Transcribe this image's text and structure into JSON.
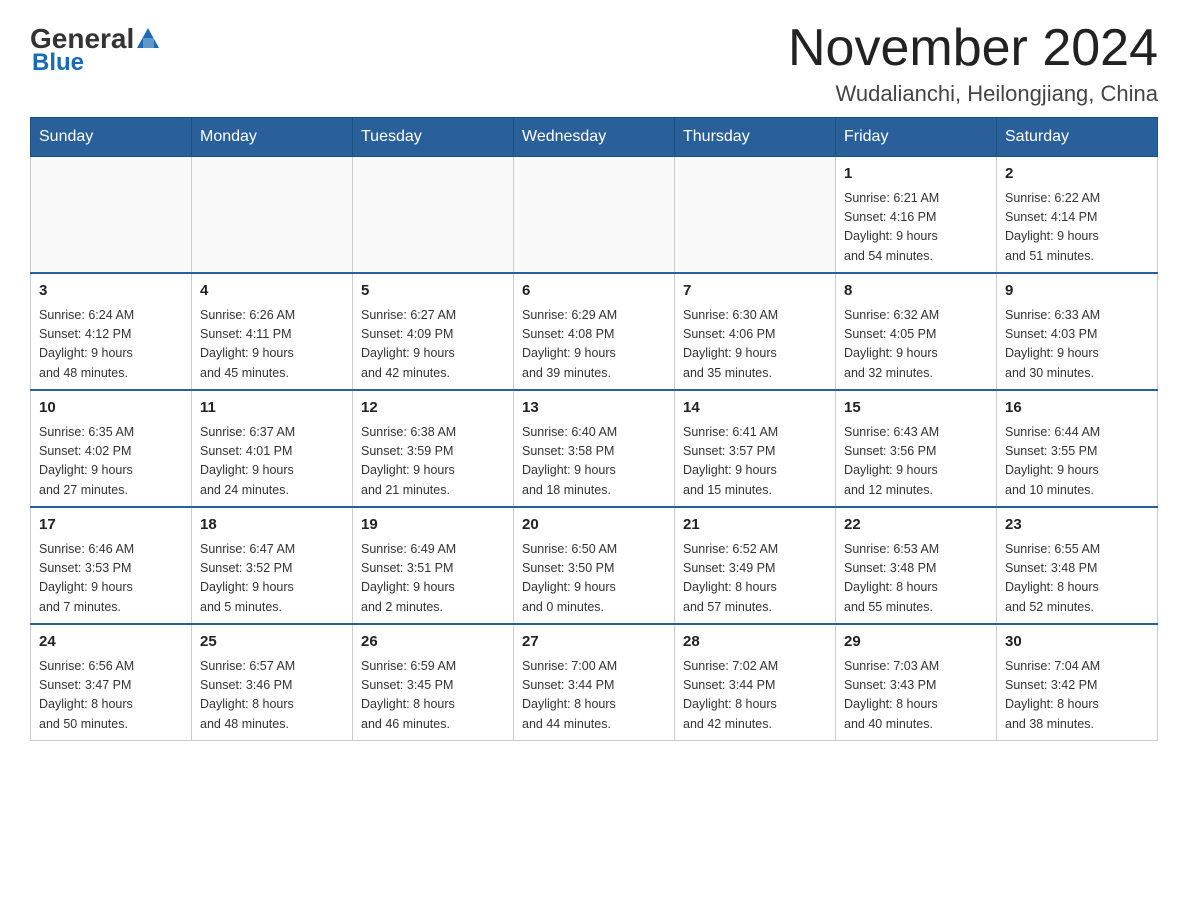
{
  "logo": {
    "text1": "General",
    "text2": "Blue"
  },
  "title": "November 2024",
  "subtitle": "Wudalianchi, Heilongjiang, China",
  "headers": [
    "Sunday",
    "Monday",
    "Tuesday",
    "Wednesday",
    "Thursday",
    "Friday",
    "Saturday"
  ],
  "weeks": [
    [
      {
        "day": "",
        "info": ""
      },
      {
        "day": "",
        "info": ""
      },
      {
        "day": "",
        "info": ""
      },
      {
        "day": "",
        "info": ""
      },
      {
        "day": "",
        "info": ""
      },
      {
        "day": "1",
        "info": "Sunrise: 6:21 AM\nSunset: 4:16 PM\nDaylight: 9 hours\nand 54 minutes."
      },
      {
        "day": "2",
        "info": "Sunrise: 6:22 AM\nSunset: 4:14 PM\nDaylight: 9 hours\nand 51 minutes."
      }
    ],
    [
      {
        "day": "3",
        "info": "Sunrise: 6:24 AM\nSunset: 4:12 PM\nDaylight: 9 hours\nand 48 minutes."
      },
      {
        "day": "4",
        "info": "Sunrise: 6:26 AM\nSunset: 4:11 PM\nDaylight: 9 hours\nand 45 minutes."
      },
      {
        "day": "5",
        "info": "Sunrise: 6:27 AM\nSunset: 4:09 PM\nDaylight: 9 hours\nand 42 minutes."
      },
      {
        "day": "6",
        "info": "Sunrise: 6:29 AM\nSunset: 4:08 PM\nDaylight: 9 hours\nand 39 minutes."
      },
      {
        "day": "7",
        "info": "Sunrise: 6:30 AM\nSunset: 4:06 PM\nDaylight: 9 hours\nand 35 minutes."
      },
      {
        "day": "8",
        "info": "Sunrise: 6:32 AM\nSunset: 4:05 PM\nDaylight: 9 hours\nand 32 minutes."
      },
      {
        "day": "9",
        "info": "Sunrise: 6:33 AM\nSunset: 4:03 PM\nDaylight: 9 hours\nand 30 minutes."
      }
    ],
    [
      {
        "day": "10",
        "info": "Sunrise: 6:35 AM\nSunset: 4:02 PM\nDaylight: 9 hours\nand 27 minutes."
      },
      {
        "day": "11",
        "info": "Sunrise: 6:37 AM\nSunset: 4:01 PM\nDaylight: 9 hours\nand 24 minutes."
      },
      {
        "day": "12",
        "info": "Sunrise: 6:38 AM\nSunset: 3:59 PM\nDaylight: 9 hours\nand 21 minutes."
      },
      {
        "day": "13",
        "info": "Sunrise: 6:40 AM\nSunset: 3:58 PM\nDaylight: 9 hours\nand 18 minutes."
      },
      {
        "day": "14",
        "info": "Sunrise: 6:41 AM\nSunset: 3:57 PM\nDaylight: 9 hours\nand 15 minutes."
      },
      {
        "day": "15",
        "info": "Sunrise: 6:43 AM\nSunset: 3:56 PM\nDaylight: 9 hours\nand 12 minutes."
      },
      {
        "day": "16",
        "info": "Sunrise: 6:44 AM\nSunset: 3:55 PM\nDaylight: 9 hours\nand 10 minutes."
      }
    ],
    [
      {
        "day": "17",
        "info": "Sunrise: 6:46 AM\nSunset: 3:53 PM\nDaylight: 9 hours\nand 7 minutes."
      },
      {
        "day": "18",
        "info": "Sunrise: 6:47 AM\nSunset: 3:52 PM\nDaylight: 9 hours\nand 5 minutes."
      },
      {
        "day": "19",
        "info": "Sunrise: 6:49 AM\nSunset: 3:51 PM\nDaylight: 9 hours\nand 2 minutes."
      },
      {
        "day": "20",
        "info": "Sunrise: 6:50 AM\nSunset: 3:50 PM\nDaylight: 9 hours\nand 0 minutes."
      },
      {
        "day": "21",
        "info": "Sunrise: 6:52 AM\nSunset: 3:49 PM\nDaylight: 8 hours\nand 57 minutes."
      },
      {
        "day": "22",
        "info": "Sunrise: 6:53 AM\nSunset: 3:48 PM\nDaylight: 8 hours\nand 55 minutes."
      },
      {
        "day": "23",
        "info": "Sunrise: 6:55 AM\nSunset: 3:48 PM\nDaylight: 8 hours\nand 52 minutes."
      }
    ],
    [
      {
        "day": "24",
        "info": "Sunrise: 6:56 AM\nSunset: 3:47 PM\nDaylight: 8 hours\nand 50 minutes."
      },
      {
        "day": "25",
        "info": "Sunrise: 6:57 AM\nSunset: 3:46 PM\nDaylight: 8 hours\nand 48 minutes."
      },
      {
        "day": "26",
        "info": "Sunrise: 6:59 AM\nSunset: 3:45 PM\nDaylight: 8 hours\nand 46 minutes."
      },
      {
        "day": "27",
        "info": "Sunrise: 7:00 AM\nSunset: 3:44 PM\nDaylight: 8 hours\nand 44 minutes."
      },
      {
        "day": "28",
        "info": "Sunrise: 7:02 AM\nSunset: 3:44 PM\nDaylight: 8 hours\nand 42 minutes."
      },
      {
        "day": "29",
        "info": "Sunrise: 7:03 AM\nSunset: 3:43 PM\nDaylight: 8 hours\nand 40 minutes."
      },
      {
        "day": "30",
        "info": "Sunrise: 7:04 AM\nSunset: 3:42 PM\nDaylight: 8 hours\nand 38 minutes."
      }
    ]
  ]
}
